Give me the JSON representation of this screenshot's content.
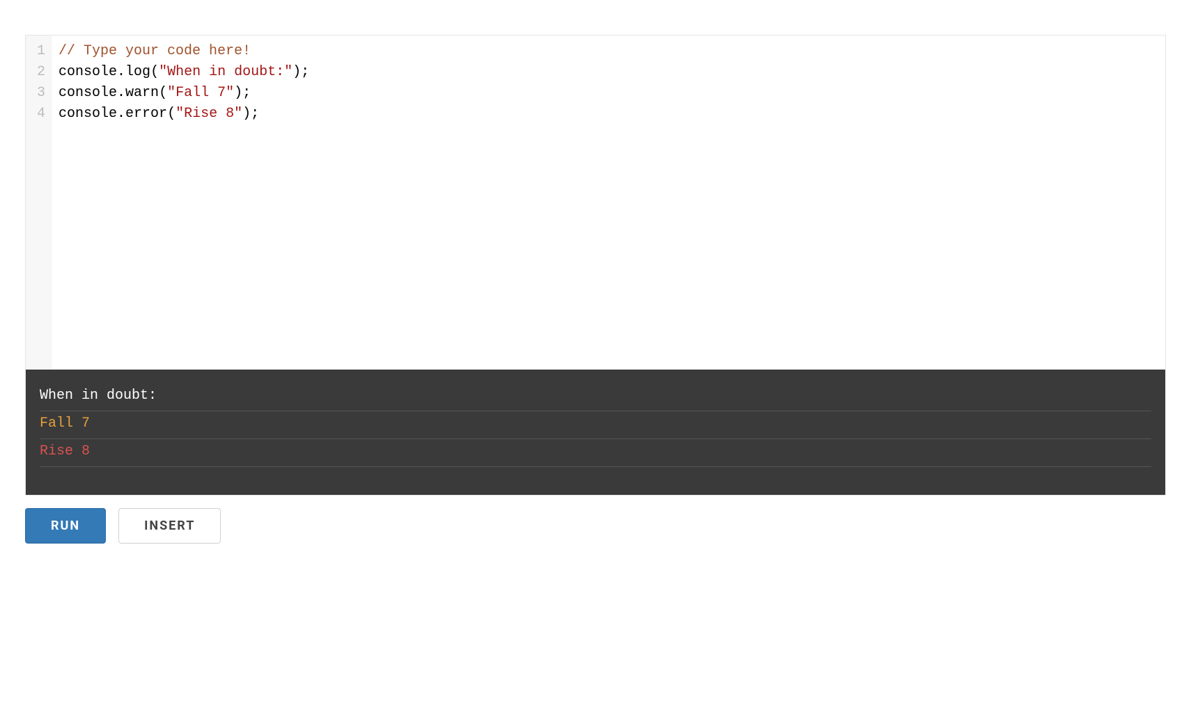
{
  "editor": {
    "lines": [
      {
        "n": "1",
        "tokens": [
          {
            "cls": "tok-comment",
            "text": "// Type your code here!"
          }
        ]
      },
      {
        "n": "2",
        "tokens": [
          {
            "cls": "tok-ident",
            "text": "console"
          },
          {
            "cls": "tok-punct",
            "text": "."
          },
          {
            "cls": "tok-ident",
            "text": "log"
          },
          {
            "cls": "tok-paren",
            "text": "("
          },
          {
            "cls": "tok-string",
            "text": "\"When in doubt:\""
          },
          {
            "cls": "tok-paren",
            "text": ")"
          },
          {
            "cls": "tok-punct",
            "text": ";"
          }
        ]
      },
      {
        "n": "3",
        "tokens": [
          {
            "cls": "tok-ident",
            "text": "console"
          },
          {
            "cls": "tok-punct",
            "text": "."
          },
          {
            "cls": "tok-ident",
            "text": "warn"
          },
          {
            "cls": "tok-paren",
            "text": "("
          },
          {
            "cls": "tok-string",
            "text": "\"Fall 7\""
          },
          {
            "cls": "tok-paren",
            "text": ")"
          },
          {
            "cls": "tok-punct",
            "text": ";"
          }
        ]
      },
      {
        "n": "4",
        "tokens": [
          {
            "cls": "tok-ident",
            "text": "console"
          },
          {
            "cls": "tok-punct",
            "text": "."
          },
          {
            "cls": "tok-ident",
            "text": "error"
          },
          {
            "cls": "tok-paren",
            "text": "("
          },
          {
            "cls": "tok-string",
            "text": "\"Rise 8\""
          },
          {
            "cls": "tok-paren",
            "text": ")"
          },
          {
            "cls": "tok-punct",
            "text": ";"
          }
        ]
      }
    ]
  },
  "console": {
    "entries": [
      {
        "level": "log",
        "text": "When in doubt:"
      },
      {
        "level": "warn",
        "text": "Fall 7"
      },
      {
        "level": "error",
        "text": "Rise 8"
      }
    ]
  },
  "toolbar": {
    "run_label": "Run",
    "insert_label": "Insert"
  }
}
